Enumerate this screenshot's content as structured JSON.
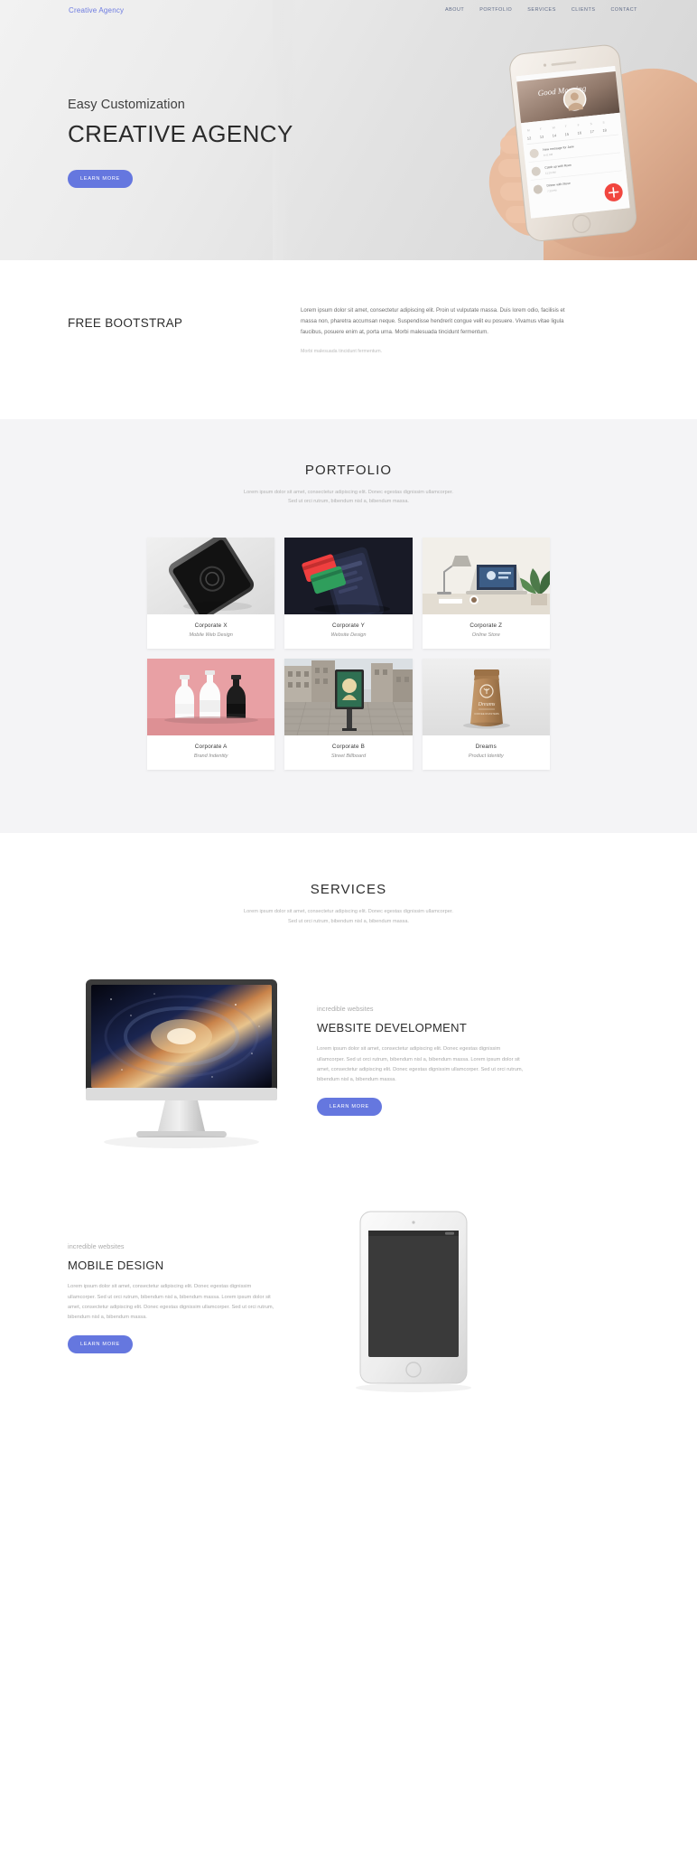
{
  "nav": {
    "brand": "Creative Agency",
    "links": [
      {
        "label": "ABOUT"
      },
      {
        "label": "PORTFOLIO"
      },
      {
        "label": "SERVICES"
      },
      {
        "label": "CLIENTS"
      },
      {
        "label": "CONTACT"
      }
    ]
  },
  "hero": {
    "subtitle": "Easy Customization",
    "title": "CREATIVE AGENCY",
    "button": "LEARN MORE",
    "phone": {
      "greeting": "Good Morning",
      "rows": [
        {
          "title": "New message for Jane",
          "meta": ""
        },
        {
          "title": "Catch up with Ryan",
          "meta": ""
        },
        {
          "title": "Dinner with Steve",
          "meta": ""
        }
      ]
    }
  },
  "intro": {
    "title": "FREE BOOTSTRAP",
    "body": "Lorem ipsum dolor sit amet, consectetur adipiscing elit. Proin ut vulputate massa. Duis lorem odio, facilisis et massa non, pharetra accumsan neque. Suspendisse hendrerit congue velit eu posuere. Vivamus vitae ligula faucibus, posuere enim at, porta urna. Morbi malesuada tincidunt fermentum.",
    "note": "Morbi malesuada tincidunt fermentum."
  },
  "portfolio": {
    "title": "PORTFOLIO",
    "subtitle_line1": "Lorem ipsum dolor sit amet, consectetur adipiscing elit. Donec egestas dignissim ullamcorper.",
    "subtitle_line2": "Sed ut orci rutrum, bibendum nisl a, bibendum massa.",
    "items": [
      {
        "title": "Corporate X",
        "category": "Mobile Web Design"
      },
      {
        "title": "Corporate Y",
        "category": "Website Design"
      },
      {
        "title": "Corporate Z",
        "category": "Online Store"
      },
      {
        "title": "Corporate A",
        "category": "Brand Indentity"
      },
      {
        "title": "Corporate B",
        "category": "Street Billboard"
      },
      {
        "title": "Dreams",
        "category": "Product Identity"
      }
    ]
  },
  "services": {
    "title": "SERVICES",
    "subtitle_line1": "Lorem ipsum dolor sit amet, consectetur adipiscing elit. Donec egestas dignissim ullamcorper.",
    "subtitle_line2": "Sed ut orci rutrum, bibendum nisl a, bibendum massa.",
    "items": [
      {
        "kicker": "incredible websites",
        "title": "WEBSITE DEVELOPMENT",
        "body": "Lorem ipsum dolor sit amet, consectetur adipiscing elit. Donec egestas dignissim ullamcorper. Sed ut orci rutrum, bibendum nisl a, bibendum massa. Lorem ipsum dolor sit amet, consectetur adipiscing elit. Donec egestas dignissim ullamcorper. Sed ut orci rutrum, bibendum nisl a, bibendum massa.",
        "button": "LEARN MORE"
      },
      {
        "kicker": "incredible websites",
        "title": "MOBILE DESIGN",
        "body": "Lorem ipsum dolor sit amet, consectetur adipiscing elit. Donec egestas dignissim ullamcorper. Sed ut orci rutrum, bibendum nisl a, bibendum massa. Lorem ipsum dolor sit amet, consectetur adipiscing elit. Donec egestas dignissim ullamcorper. Sed ut orci rutrum, bibendum nisl a, bibendum massa.",
        "button": "LEARN MORE"
      }
    ]
  },
  "colors": {
    "accent": "#6577df",
    "grey_bg": "#f4f4f6",
    "heading": "#2d2d2d",
    "muted": "#b1b1b1"
  }
}
